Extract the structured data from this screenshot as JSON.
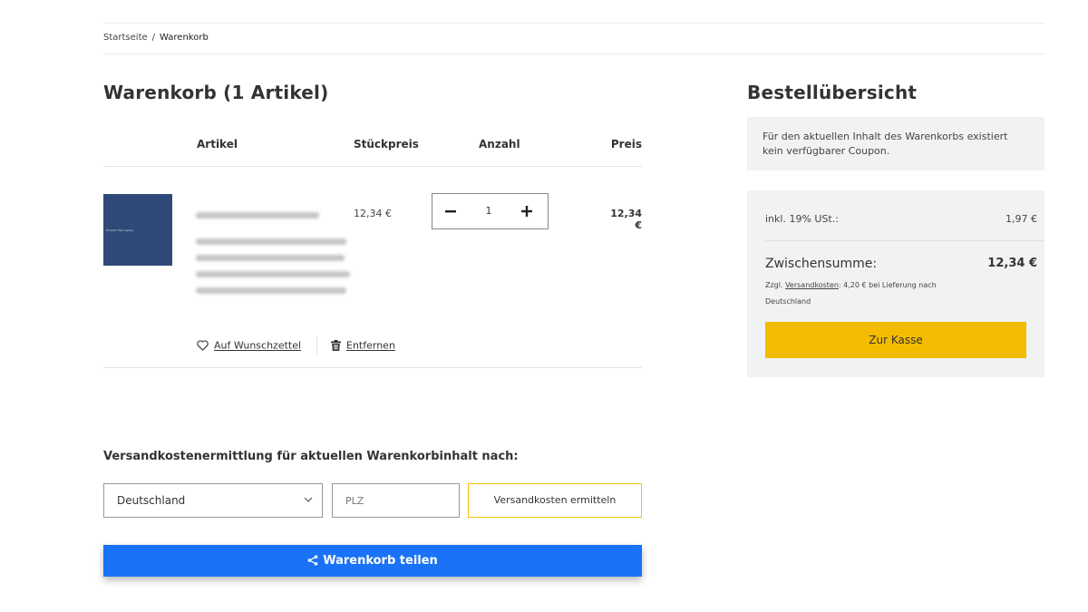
{
  "breadcrumb": {
    "home": "Startseite",
    "separator": "/",
    "current": "Warenkorb"
  },
  "cart": {
    "title": "Warenkorb (1 Artikel)",
    "columns": {
      "article": "Artikel",
      "unit_price": "Stückpreis",
      "quantity": "Anzahl",
      "price": "Preis"
    },
    "item": {
      "thumbnail_text": "Produkt Titel Laptop",
      "unit_price": "12,34 €",
      "quantity": "1",
      "line_total": "12,34 €",
      "wishlist_label": "Auf Wunschzettel",
      "remove_label": "Entfernen"
    }
  },
  "shipping": {
    "title": "Versandkostenermittlung für aktuellen Warenkorbinhalt nach:",
    "country": "Deutschland",
    "zip_placeholder": "PLZ",
    "calculate_label": "Versandkosten ermitteln"
  },
  "share": {
    "label": "Warenkorb teilen"
  },
  "summary": {
    "title": "Bestellübersicht",
    "coupon_notice": "Für den aktuellen Inhalt des Warenkorbs existiert kein verfügbarer Coupon.",
    "vat_label": "inkl. 19% USt.:",
    "vat_value": "1,97 €",
    "subtotal_label": "Zwischensumme:",
    "subtotal_value": "12,34 €",
    "shipping_note_prefix": "Zzgl.",
    "shipping_note_link": "Versandkosten",
    "shipping_note_suffix": ": 4,20 € bei Lieferung nach Deutschland",
    "checkout_label": "Zur Kasse"
  },
  "colors": {
    "checkout": "#f4bc00",
    "share": "#1a73f7",
    "thumbnail": "#2f4a78",
    "panel": "#f1f2f4"
  },
  "icons": {
    "wishlist": "heart-icon",
    "remove": "trash-icon",
    "share": "share-icon",
    "dropdown": "chevron-down-icon",
    "minus": "minus-icon",
    "plus": "plus-icon"
  }
}
